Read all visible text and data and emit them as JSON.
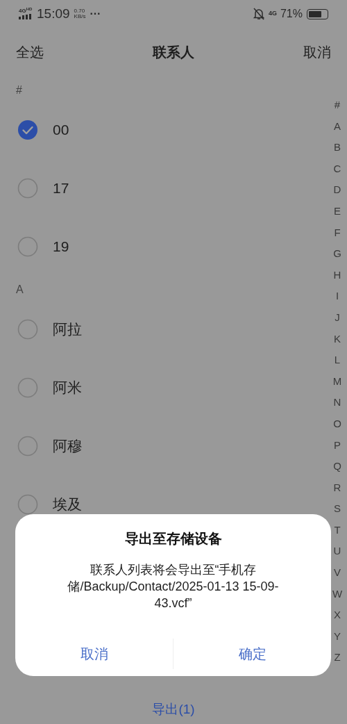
{
  "status_bar": {
    "network": "4G",
    "network_sup": "HD",
    "time": "15:09",
    "speed_value": "0.70",
    "speed_unit": "KB/s",
    "more": "···",
    "mobile": "4G",
    "battery_text": "71%"
  },
  "header": {
    "left": "全选",
    "title": "联系人",
    "right": "取消"
  },
  "sections": [
    {
      "letter": "#",
      "contacts": [
        {
          "name": "00",
          "checked": true
        },
        {
          "name": "17",
          "checked": false
        },
        {
          "name": "19",
          "checked": false
        }
      ]
    },
    {
      "letter": "A",
      "contacts": [
        {
          "name": "阿拉",
          "checked": false
        },
        {
          "name": "阿米",
          "checked": false
        },
        {
          "name": "阿穆",
          "checked": false
        },
        {
          "name": "埃及",
          "checked": false
        }
      ]
    }
  ],
  "index": [
    "#",
    "A",
    "B",
    "C",
    "D",
    "E",
    "F",
    "G",
    "H",
    "I",
    "J",
    "K",
    "L",
    "M",
    "N",
    "O",
    "P",
    "Q",
    "R",
    "S",
    "T",
    "U",
    "V",
    "W",
    "X",
    "Y",
    "Z"
  ],
  "dialog": {
    "title": "导出至存储设备",
    "message": "联系人列表将会导出至“手机存储/Backup/Contact/2025-01-13 15-09-43.vcf”",
    "buttons": [
      "取消",
      "确定"
    ]
  },
  "bottom_bar": {
    "label": "导出(1)"
  }
}
